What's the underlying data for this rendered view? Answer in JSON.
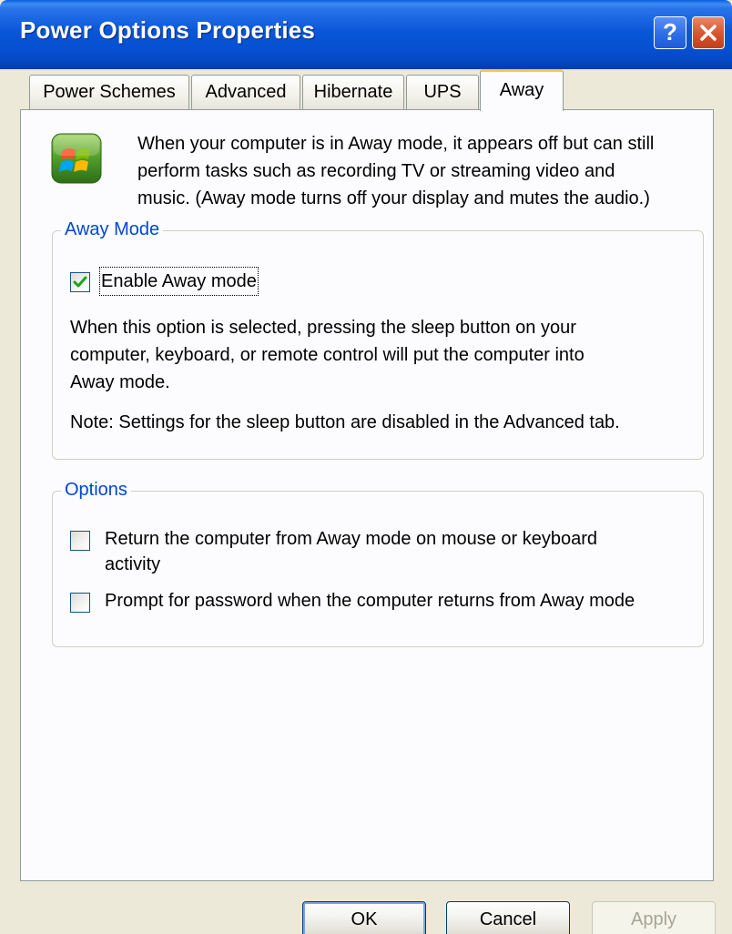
{
  "window": {
    "title": "Power Options Properties"
  },
  "titlebar": {
    "help_label": "?"
  },
  "tabs": [
    {
      "label": "Power Schemes"
    },
    {
      "label": "Advanced"
    },
    {
      "label": "Hibernate"
    },
    {
      "label": "UPS"
    },
    {
      "label": "Away",
      "active": true
    }
  ],
  "intro": {
    "line1": "When your computer is in Away mode, it appears off but can still",
    "line2": "perform tasks such as recording TV or streaming video and",
    "line3": "music. (Away mode turns off your display and mutes the audio.)"
  },
  "away_mode": {
    "group_label": "Away Mode",
    "checkbox_label": "Enable Away mode",
    "checked": true,
    "desc_line1": "When this option is selected, pressing the sleep button on your",
    "desc_line2": "computer, keyboard, or remote control will put the computer into",
    "desc_line3": "Away mode.",
    "note": "Note: Settings for the sleep button are disabled in the Advanced tab."
  },
  "options": {
    "group_label": "Options",
    "return_label_line1": "Return the computer from Away mode on mouse or keyboard",
    "return_label_line2": "activity",
    "return_checked": false,
    "prompt_label": "Prompt for password when the computer returns from Away mode",
    "prompt_checked": false
  },
  "buttons": {
    "ok": "OK",
    "cancel": "Cancel",
    "apply": "Apply"
  },
  "icons": {
    "app_icon": "windows-media-center-icon"
  },
  "colors": {
    "group_label": "#0046d5",
    "titlebar": "#0650d2",
    "tab_highlight": "#ffc83c"
  }
}
